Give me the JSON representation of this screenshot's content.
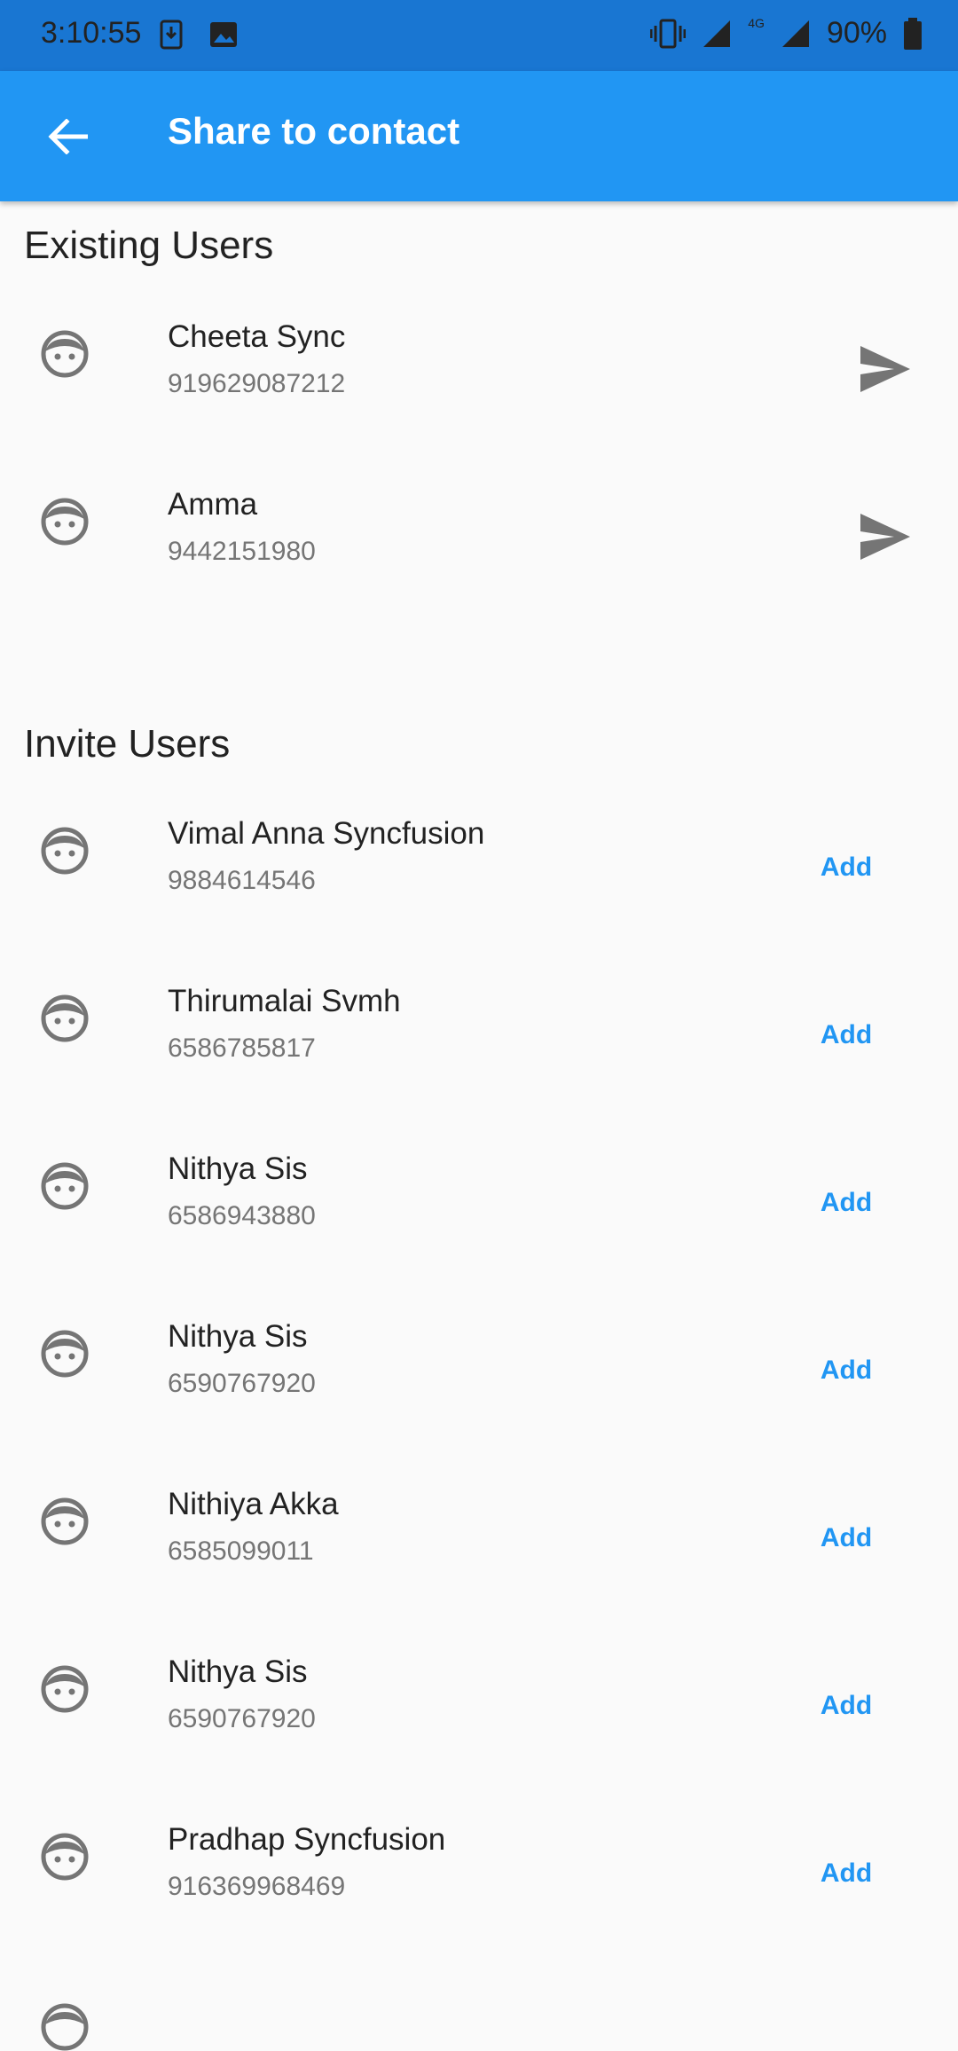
{
  "status_bar": {
    "time": "3:10:55",
    "network": "4G",
    "battery": "90%"
  },
  "app_bar": {
    "title": "Share to contact",
    "back_icon": "arrow-back-icon"
  },
  "existing_users": {
    "title": "Existing Users",
    "items": [
      {
        "name": "Cheeta Sync",
        "phone": "919629087212"
      },
      {
        "name": "Amma",
        "phone": "9442151980"
      }
    ]
  },
  "invite_users": {
    "title": "Invite Users",
    "add_label": "Add",
    "items": [
      {
        "name": "Vimal Anna Syncfusion",
        "phone": "9884614546"
      },
      {
        "name": "Thirumalai Svmh",
        "phone": "6586785817"
      },
      {
        "name": "Nithya Sis",
        "phone": "6586943880"
      },
      {
        "name": "Nithya Sis",
        "phone": "6590767920"
      },
      {
        "name": "Nithiya Akka",
        "phone": "6585099011"
      },
      {
        "name": "Nithya Sis",
        "phone": "6590767920"
      },
      {
        "name": "Pradhap Syncfusion",
        "phone": "916369968469"
      }
    ]
  },
  "colors": {
    "status_bar": "#1976D2",
    "app_bar": "#2196F3",
    "accent": "#2196F3",
    "icon_gray": "#757575"
  }
}
